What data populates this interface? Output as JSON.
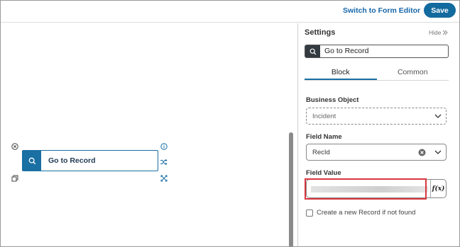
{
  "topbar": {
    "switch_label": "Switch to Form Editor",
    "save_label": "Save"
  },
  "canvas": {
    "block_label": "Go to Record",
    "icons": [
      "close-circle-icon",
      "info-icon",
      "shuffle-icon",
      "expand-icon",
      "copy-icon",
      "search-icon"
    ]
  },
  "settings": {
    "title": "Settings",
    "hide_label": "Hide",
    "block_search_value": "Go to Record",
    "tabs": [
      {
        "label": "Block",
        "active": true
      },
      {
        "label": "Common",
        "active": false
      }
    ],
    "business_object": {
      "label": "Business Object",
      "value": "Incident"
    },
    "field_name": {
      "label": "Field Name",
      "value": "RecId"
    },
    "field_value": {
      "label": "Field Value",
      "fx_label": "f(x)"
    },
    "create_checkbox": {
      "label": "Create a new Record if not found",
      "checked": false
    }
  },
  "colors": {
    "accent": "#1a6fa3",
    "save": "#136a9e",
    "highlight": "#d9363e"
  }
}
